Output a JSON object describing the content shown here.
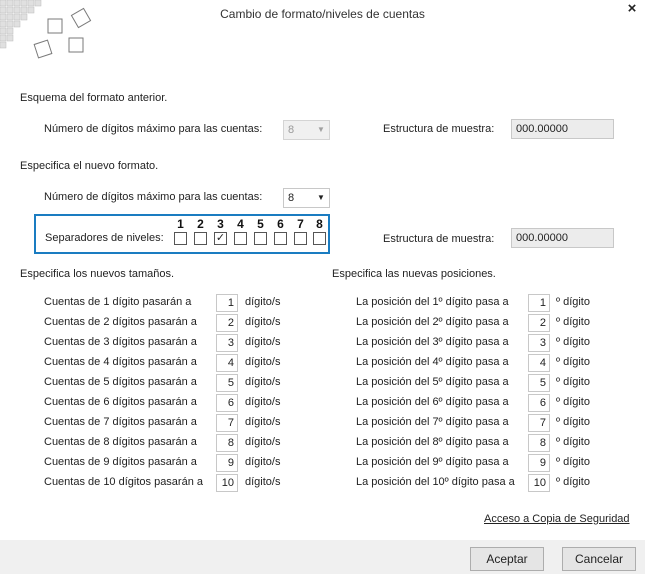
{
  "window": {
    "title": "Cambio de formato/niveles de cuentas",
    "close_icon": "×"
  },
  "old_format": {
    "heading": "Esquema del formato anterior.",
    "digits_label": "Número de dígitos máximo para las cuentas:",
    "digits_value": "8",
    "sample_label": "Estructura de muestra:",
    "sample_value": "000.00000"
  },
  "new_format": {
    "heading": "Especifica el nuevo formato.",
    "digits_label": "Número de dígitos máximo para las cuentas:",
    "digits_value": "8",
    "separators_label": "Separadores de niveles:",
    "levels": [
      "1",
      "2",
      "3",
      "4",
      "5",
      "6",
      "7",
      "8"
    ],
    "checked": [
      false,
      false,
      true,
      false,
      false,
      false,
      false,
      false
    ],
    "sample_label": "Estructura de muestra:",
    "sample_value": "000.00000"
  },
  "sizes": {
    "heading": "Especifica los nuevos tamaños.",
    "unit": "dígito/s",
    "rows": [
      {
        "label": "Cuentas de 1 dígito pasarán a",
        "value": "1"
      },
      {
        "label": "Cuentas de 2 dígitos pasarán a",
        "value": "2"
      },
      {
        "label": "Cuentas de 3 dígitos pasarán a",
        "value": "3"
      },
      {
        "label": "Cuentas de 4 dígitos pasarán a",
        "value": "4"
      },
      {
        "label": "Cuentas de 5 dígitos pasarán a",
        "value": "5"
      },
      {
        "label": "Cuentas de 6 dígitos pasarán a",
        "value": "6"
      },
      {
        "label": "Cuentas de 7 dígitos pasarán a",
        "value": "7"
      },
      {
        "label": "Cuentas de 8 dígitos pasarán a",
        "value": "8"
      },
      {
        "label": "Cuentas de 9 dígitos pasarán a",
        "value": "9"
      },
      {
        "label": "Cuentas de 10 dígitos pasarán a",
        "value": "10"
      }
    ]
  },
  "positions": {
    "heading": "Especifica las nuevas posiciones.",
    "unit": "º dígito",
    "rows": [
      {
        "label": "La posición del 1º dígito pasa a",
        "value": "1"
      },
      {
        "label": "La posición del 2º dígito pasa a",
        "value": "2"
      },
      {
        "label": "La posición del 3º dígito pasa a",
        "value": "3"
      },
      {
        "label": "La posición del 4º dígito pasa a",
        "value": "4"
      },
      {
        "label": "La posición del 5º dígito pasa a",
        "value": "5"
      },
      {
        "label": "La posición del 6º dígito pasa a",
        "value": "6"
      },
      {
        "label": "La posición del 7º dígito pasa a",
        "value": "7"
      },
      {
        "label": "La posición del 8º dígito pasa a",
        "value": "8"
      },
      {
        "label": "La posición del 9º dígito pasa a",
        "value": "9"
      },
      {
        "label": "La posición del 10º dígito pasa a",
        "value": "10"
      }
    ]
  },
  "link": {
    "label": "Acceso a Copia de Seguridad"
  },
  "buttons": {
    "accept": "Aceptar",
    "cancel": "Cancelar"
  },
  "icons": {
    "dropdown": "▼",
    "check": "✓"
  },
  "colors": {
    "accent_border": "#1a7cc1",
    "footer_bg": "#f0f0f0"
  }
}
